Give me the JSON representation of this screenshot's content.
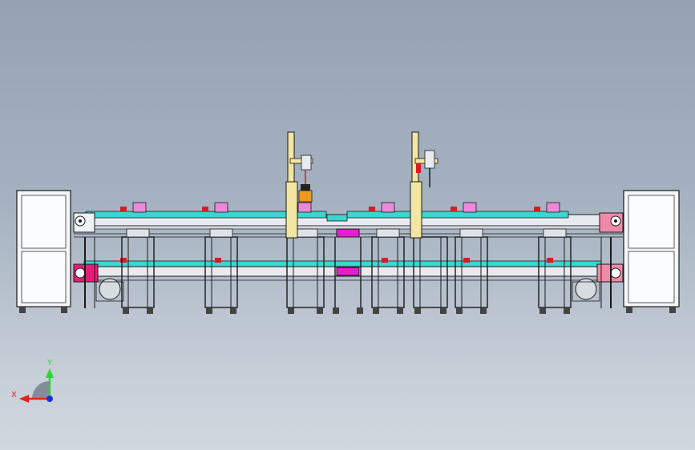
{
  "view": {
    "background_top": "#95a2b4",
    "background_bottom": "#d2d8df"
  },
  "triad": {
    "y_label": "Y",
    "x_label": "X",
    "y_color": "#2fd33a",
    "x_color": "#e2231e",
    "z_color": "#1f2fd6"
  },
  "colors": {
    "frame": "#f4f6f8",
    "outline": "#1b1b1b",
    "conveyor_belt": "#3cd6d0",
    "fixture": "#e88ad8",
    "magenta_block": "#e61ed2",
    "pink_block": "#ef8aa6",
    "gantry_yellow": "#f2e6a2",
    "orange_box": "#ef9a1e",
    "red_part": "#d02020"
  }
}
